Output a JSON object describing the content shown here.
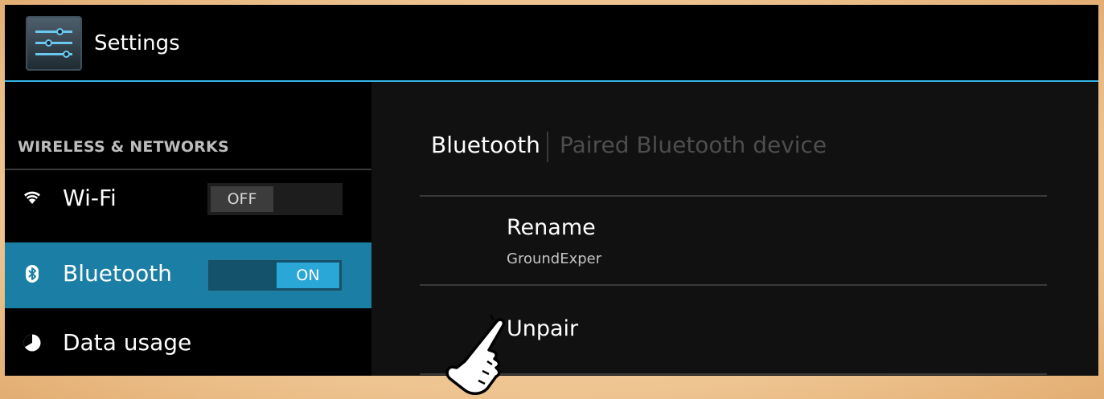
{
  "action_bar": {
    "app_icon": "settings-sliders-icon",
    "title": "Settings"
  },
  "sidebar": {
    "section_header": "WIRELESS & NETWORKS",
    "items": [
      {
        "label": "Wi-Fi",
        "icon": "wifi-icon",
        "toggle": "OFF",
        "selected": false
      },
      {
        "label": "Bluetooth",
        "icon": "bluetooth-icon",
        "toggle": "ON",
        "selected": true
      },
      {
        "label": "Data usage",
        "icon": "data-usage-icon",
        "selected": false
      }
    ]
  },
  "detail": {
    "breadcrumb": "Bluetooth",
    "subtitle": "Paired Bluetooth device",
    "prefs": [
      {
        "title": "Rename",
        "summary": "GroundExper"
      },
      {
        "title": "Unpair"
      }
    ]
  },
  "cursor": {
    "icon": "hand-pointer-icon"
  },
  "colors": {
    "accent": "#33b5e5",
    "selected_item": "#1b7fa5",
    "frame": "#f0c89a"
  }
}
